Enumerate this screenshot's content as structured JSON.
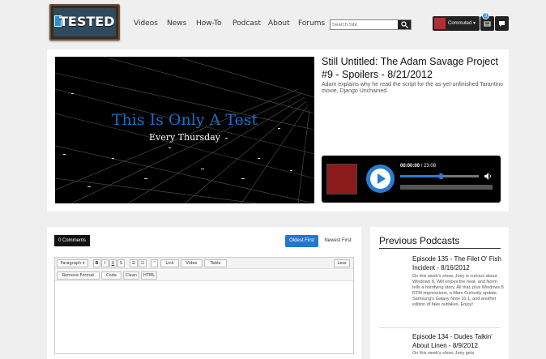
{
  "logo": {
    "text": "TESTED"
  },
  "nav": {
    "items": [
      "Videos",
      "News",
      "How-To",
      "Podcast",
      "About",
      "Forums"
    ]
  },
  "search": {
    "placeholder": "Search Site"
  },
  "user": {
    "name": "Commuted ▾"
  },
  "notifications": {
    "count": "3"
  },
  "feature": {
    "hero_title": "This Is Only A Test",
    "hero_subtitle": "Every Thursday",
    "title": "Still Untitled: The Adam Savage Project #9 - Spoilers - 8/21/2012",
    "description": "Adam explains why he read the script for the as-yet-unfinished Tarantino movie, Django Unchained.",
    "player": {
      "current_time": "00:00:00",
      "duration": "23:08",
      "progress_fraction": 0.52
    }
  },
  "comments": {
    "count_label": "0 Comments",
    "sort_oldest": "Oldest First",
    "sort_newest": "Newest First",
    "toolbar1": [
      "Paragraph ▾",
      "B",
      "I",
      "U",
      "S",
      "☰",
      "☷",
      "“",
      "Link",
      "Video",
      "Table",
      "Less"
    ],
    "toolbar2": [
      "Remove Format",
      "Code",
      "Clean",
      "HTML"
    ]
  },
  "podcasts": {
    "heading": "Previous Podcasts",
    "episodes": [
      {
        "title": "Episode 135 - The Filet O' Fish Incident - 8/16/2012",
        "description": "On this week's show, Joey is curious about Windows 8, Will enjoys the heat, and Norm tells a horrifying story. All that, plus Windows 8 RTM impressions, a Mars Curiosity update, Samsung's Galaxy Note 10.1, and another edition of fake outtakes. Enjoy!"
      },
      {
        "title": "Episode 134 - Dudes Talkin' About Linen - 8/9/2012",
        "description": "On this week's show, Joey gets"
      }
    ]
  }
}
